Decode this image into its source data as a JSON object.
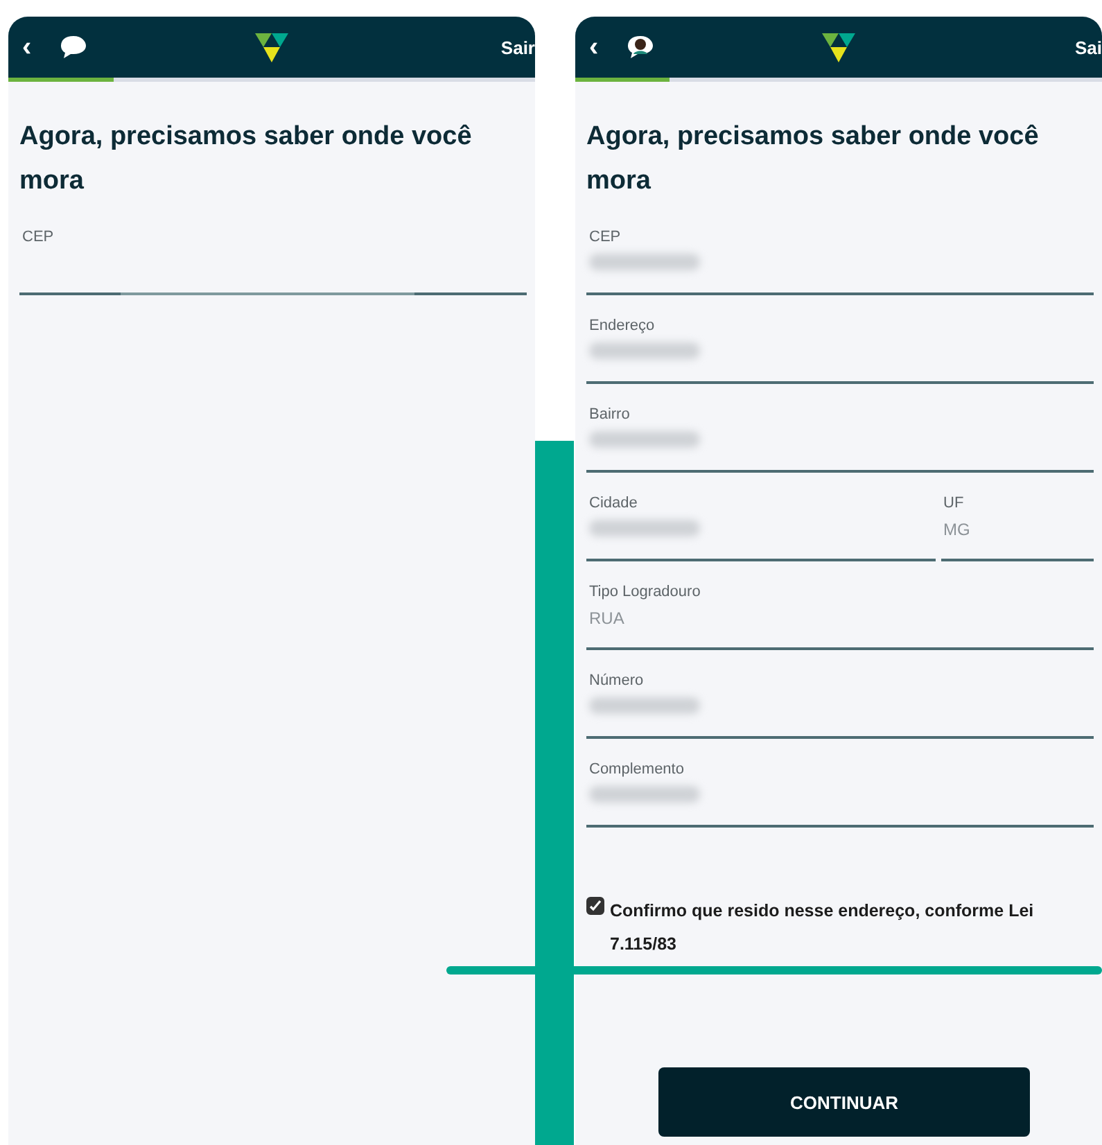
{
  "screens": [
    {
      "header": {
        "back": "‹",
        "avatar": false,
        "exit": "Sair"
      },
      "progress": {
        "level": 0.2
      },
      "title": "Agora, precisamos saber onde você mora",
      "rows": [
        [
          {
            "label": "CEP",
            "loading": true
          }
        ]
      ]
    },
    {
      "header": {
        "back": "‹",
        "avatar": true,
        "exit": "Sai"
      },
      "progress": {
        "level": 0.18
      },
      "title": "Agora, precisamos saber onde você mora",
      "rows": [
        [
          {
            "label": "CEP",
            "redacted": true
          }
        ],
        [
          {
            "label": "Endereço",
            "redacted": true
          }
        ],
        [
          {
            "label": "Bairro",
            "redacted": true
          }
        ],
        [
          {
            "label": "Cidade",
            "redacted": true
          },
          {
            "label": "UF",
            "value": "MG",
            "disabled": true
          }
        ],
        [
          {
            "label": "Tipo Logradouro",
            "value": "RUA",
            "disabled": true
          }
        ],
        [
          {
            "label": "Número",
            "redacted": true
          }
        ],
        [
          {
            "label": "Complemento",
            "redacted": true
          }
        ]
      ],
      "consent": {
        "checked": true,
        "text": "Confirmo que resido nesse endereço, conforme Lei 7.115/83"
      },
      "button": "CONTINUAR"
    }
  ]
}
